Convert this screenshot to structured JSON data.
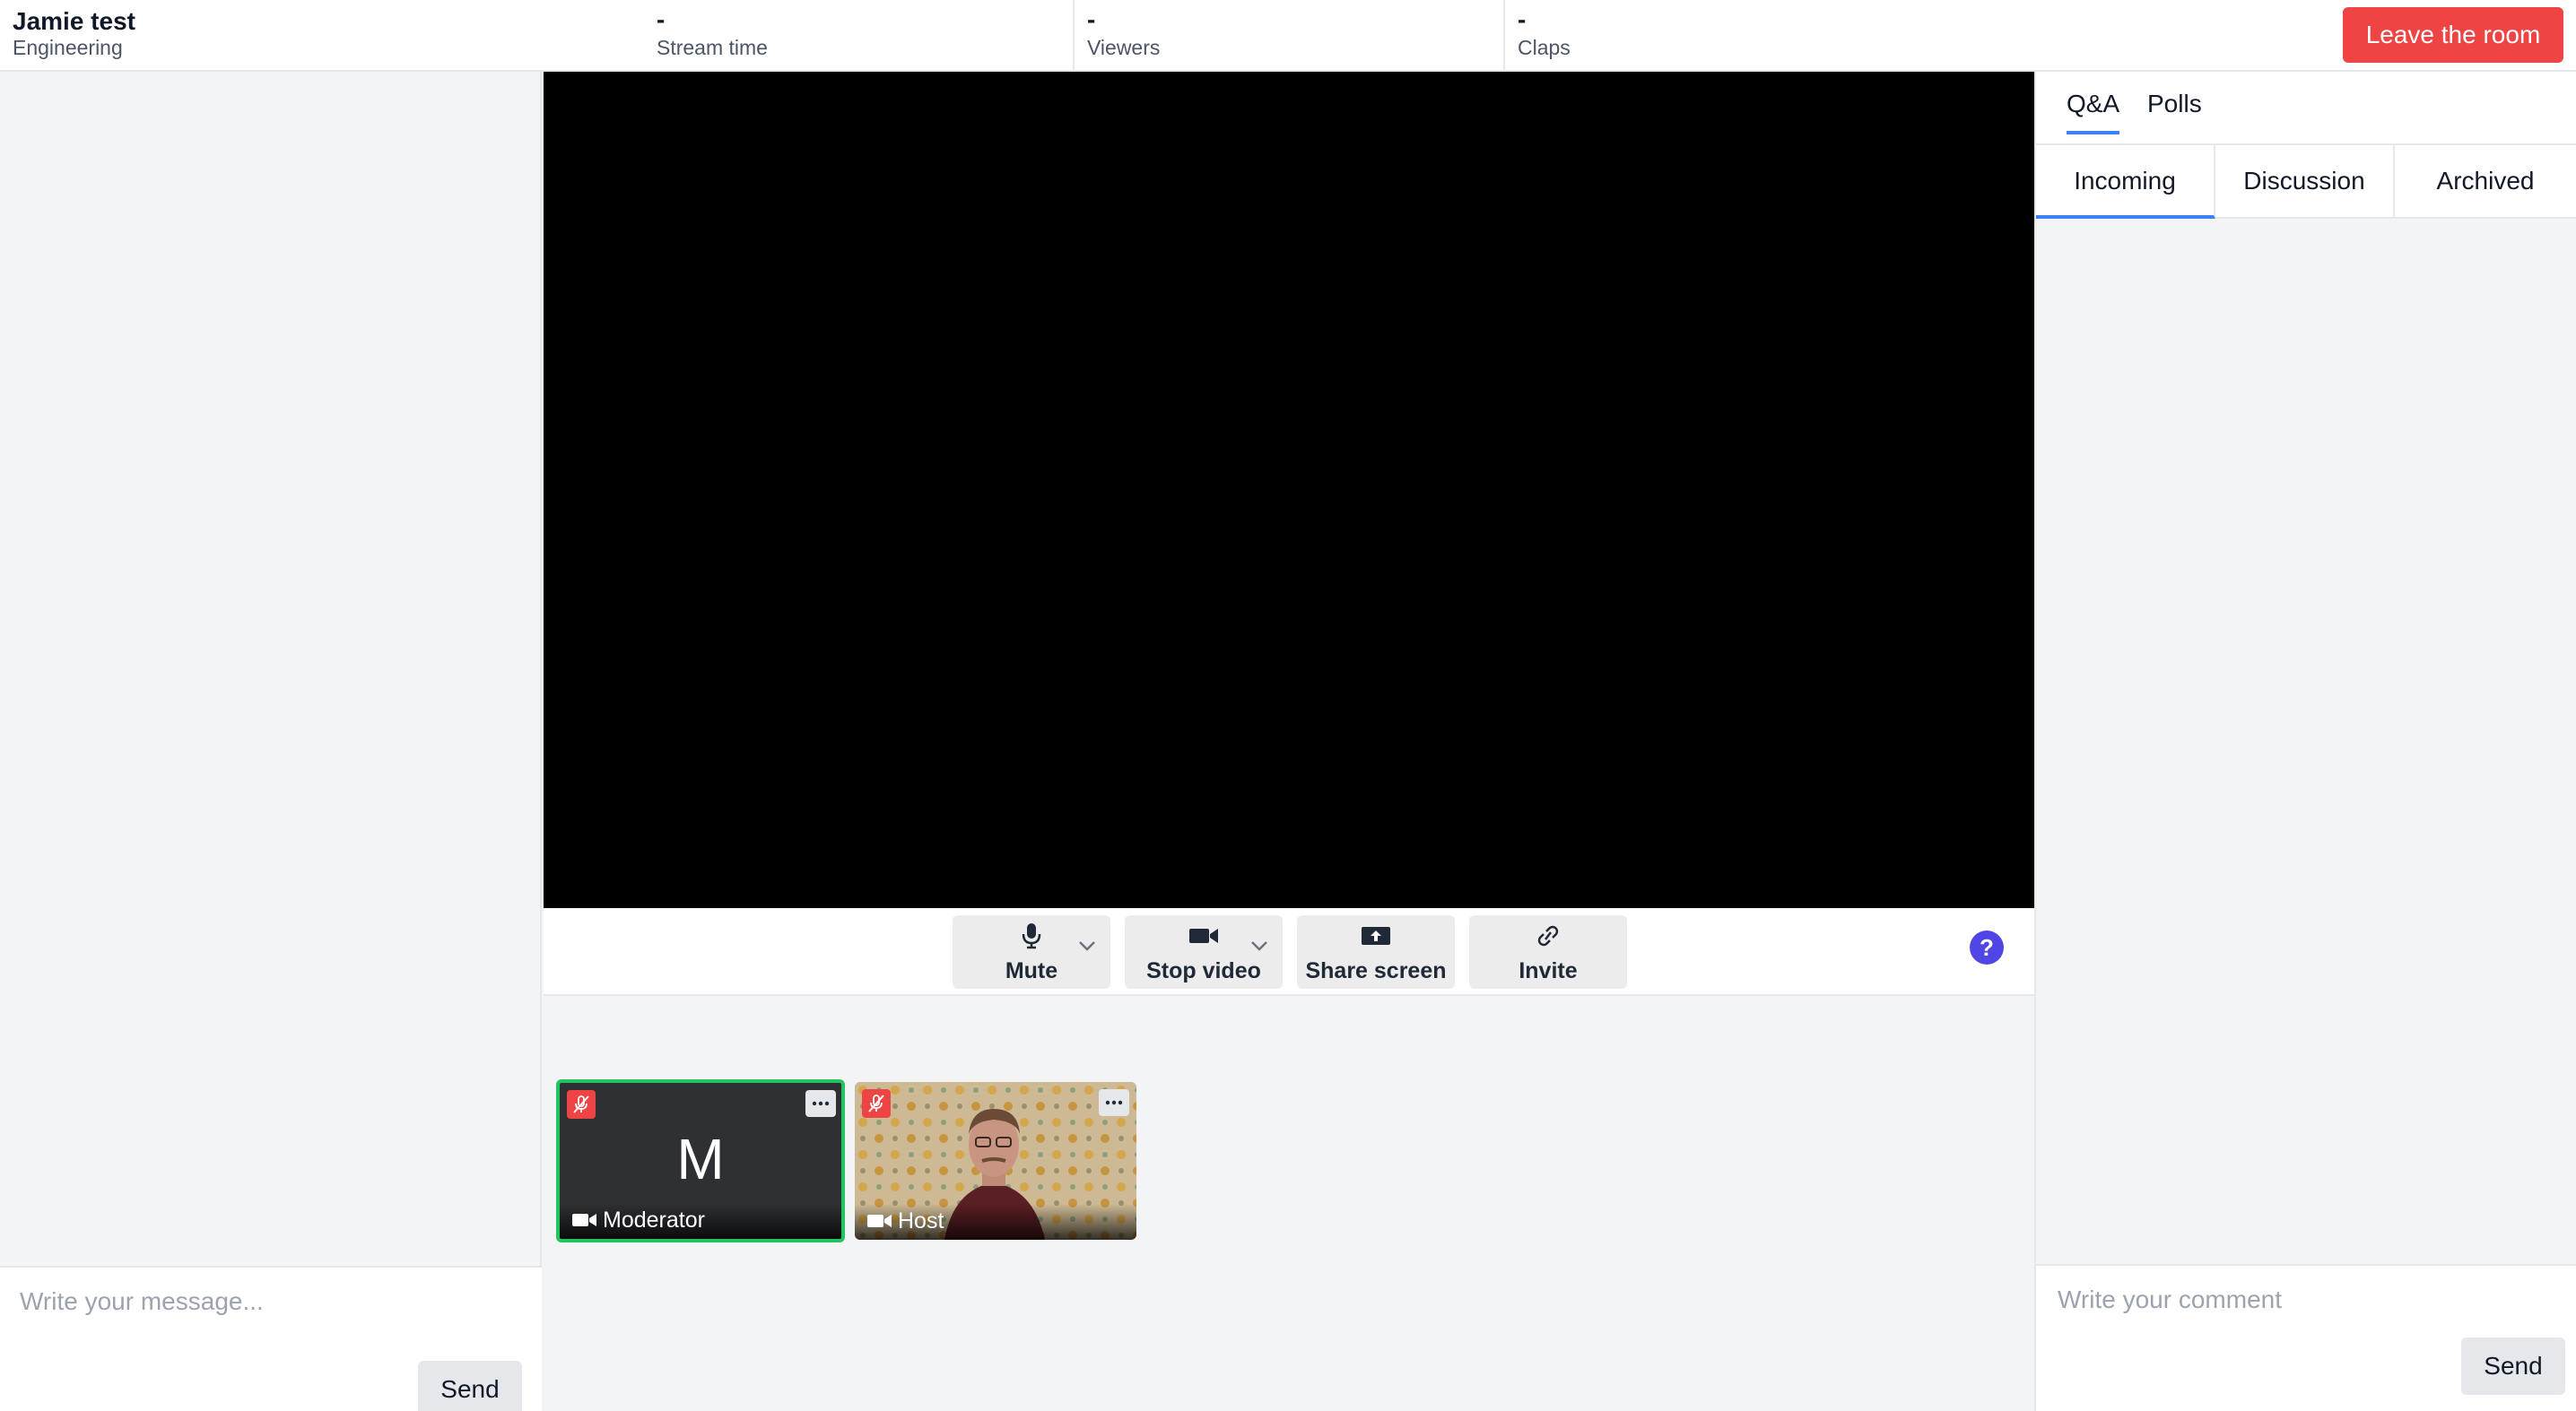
{
  "header": {
    "title": "Jamie test",
    "subtitle": "Engineering",
    "stats": [
      {
        "value": "-",
        "label": "Stream time"
      },
      {
        "value": "-",
        "label": "Viewers"
      },
      {
        "value": "-",
        "label": "Claps"
      }
    ],
    "leave_label": "Leave the room"
  },
  "chat": {
    "placeholder": "Write your message...",
    "send_label": "Send"
  },
  "toolbar": {
    "mute_label": "Mute",
    "stop_video_label": "Stop video",
    "share_screen_label": "Share screen",
    "invite_label": "Invite",
    "help_glyph": "?"
  },
  "participants": [
    {
      "initial": "M",
      "name": "Moderator",
      "mic": "muted",
      "video": "off"
    },
    {
      "initial": "",
      "name": "Host",
      "mic": "muted",
      "video": "on"
    }
  ],
  "right_panel": {
    "tabs": [
      "Q&A",
      "Polls"
    ],
    "active_tab": "Q&A",
    "subtabs": [
      "Incoming",
      "Discussion",
      "Archived"
    ],
    "active_subtab": "Incoming",
    "comment_placeholder": "Write your comment",
    "send_label": "Send"
  },
  "colors": {
    "accent": "#3b82f6",
    "danger": "#ef4444",
    "speaking_border": "#22c55e",
    "help": "#4f46e5"
  }
}
